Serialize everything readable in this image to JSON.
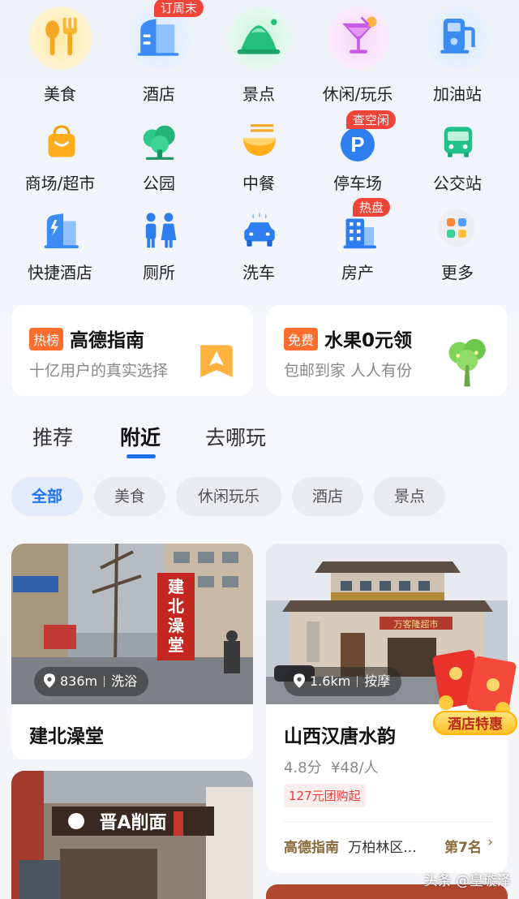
{
  "quick_access": {
    "row1": [
      {
        "label": "美食",
        "icon": "food-icon"
      },
      {
        "label": "酒店",
        "icon": "hotel-icon",
        "tag": "订周末"
      },
      {
        "label": "景点",
        "icon": "scenic-icon"
      },
      {
        "label": "休闲/玩乐",
        "icon": "cocktail-icon"
      },
      {
        "label": "加油站",
        "icon": "gas-station-icon"
      }
    ],
    "row2": [
      {
        "label": "商场/超市",
        "icon": "shopping-bag-icon"
      },
      {
        "label": "公园",
        "icon": "tree-icon"
      },
      {
        "label": "中餐",
        "icon": "noodle-bowl-icon"
      },
      {
        "label": "停车场",
        "icon": "parking-icon",
        "tag": "查空闲"
      },
      {
        "label": "公交站",
        "icon": "bus-icon"
      }
    ],
    "row3": [
      {
        "label": "快捷酒店",
        "icon": "budget-hotel-icon"
      },
      {
        "label": "厕所",
        "icon": "restroom-icon"
      },
      {
        "label": "洗车",
        "icon": "car-wash-icon"
      },
      {
        "label": "房产",
        "icon": "building-icon",
        "tag": "热盘"
      },
      {
        "label": "更多",
        "icon": "more-grid-icon"
      }
    ]
  },
  "promos": [
    {
      "badge": "热榜",
      "title": "高德指南",
      "subtitle": "十亿用户的真实选择",
      "icon": "amap-guide-icon"
    },
    {
      "badge": "免费",
      "title": "水果0元领",
      "subtitle": "包邮到家 人人有份",
      "icon": "fruit-tree-icon"
    }
  ],
  "tabs": [
    "推荐",
    "附近",
    "去哪玩"
  ],
  "active_tab": "附近",
  "chips": [
    "全部",
    "美食",
    "休闲玩乐",
    "酒店",
    "景点"
  ],
  "active_chip": "全部",
  "feed": [
    {
      "name": "建北澡堂",
      "distance": "836m",
      "category": "洗浴",
      "photo_sign_text": "建北澡堂"
    },
    {
      "name": "山西汉唐水韵",
      "distance": "1.6km",
      "category": "按摩",
      "rating": "4.8分",
      "price": "¥48/人",
      "group_deal": "127元团购起",
      "rank_brand": "高德指南",
      "rank_list": "万柏林区...",
      "rank_position": "第7名",
      "corner_badge": "酒店特惠",
      "photo_sign_text": "万客隆超市"
    },
    {
      "photo_sign_text": "晋A削面"
    }
  ],
  "watermark": "头条 @皇璇泽",
  "colors": {
    "accent": "#1a73f5",
    "badge_orange": "#ff6d2e",
    "tag_red": "#f04438"
  }
}
